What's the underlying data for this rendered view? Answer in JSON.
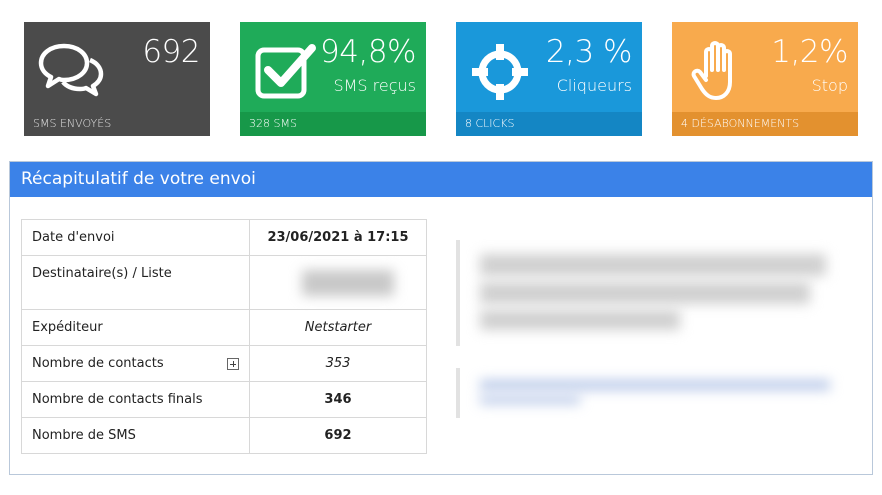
{
  "stats": [
    {
      "value": "692",
      "sublabel": "",
      "footer": "SMS ENVOYÉS",
      "icon": "chat-bubbles-icon",
      "color": "#4b4b4b"
    },
    {
      "value": "94,8%",
      "sublabel": "SMS reçus",
      "footer": "328 SMS",
      "icon": "checkbox-check-icon",
      "color": "#1fab59"
    },
    {
      "value": "2,3 %",
      "sublabel": "Cliqueurs",
      "footer": "8 CLICKS",
      "icon": "crosshair-icon",
      "color": "#1a98da"
    },
    {
      "value": "1,2%",
      "sublabel": "Stop",
      "footer": "4 DÉSABONNEMENTS",
      "icon": "hand-stop-icon",
      "color": "#f8aa4d"
    }
  ],
  "panel": {
    "title": "Récapitulatif de votre envoi",
    "rows": [
      {
        "label": "Date d'envoi",
        "value": "23/06/2021 à 17:15"
      },
      {
        "label": "Destinataire(s) / Liste",
        "value": ""
      },
      {
        "label": "Expéditeur",
        "value": "Netstarter"
      },
      {
        "label": "Nombre de contacts",
        "value": "353"
      },
      {
        "label": "Nombre de contacts finals",
        "value": "346"
      },
      {
        "label": "Nombre de SMS",
        "value": "692"
      }
    ]
  }
}
